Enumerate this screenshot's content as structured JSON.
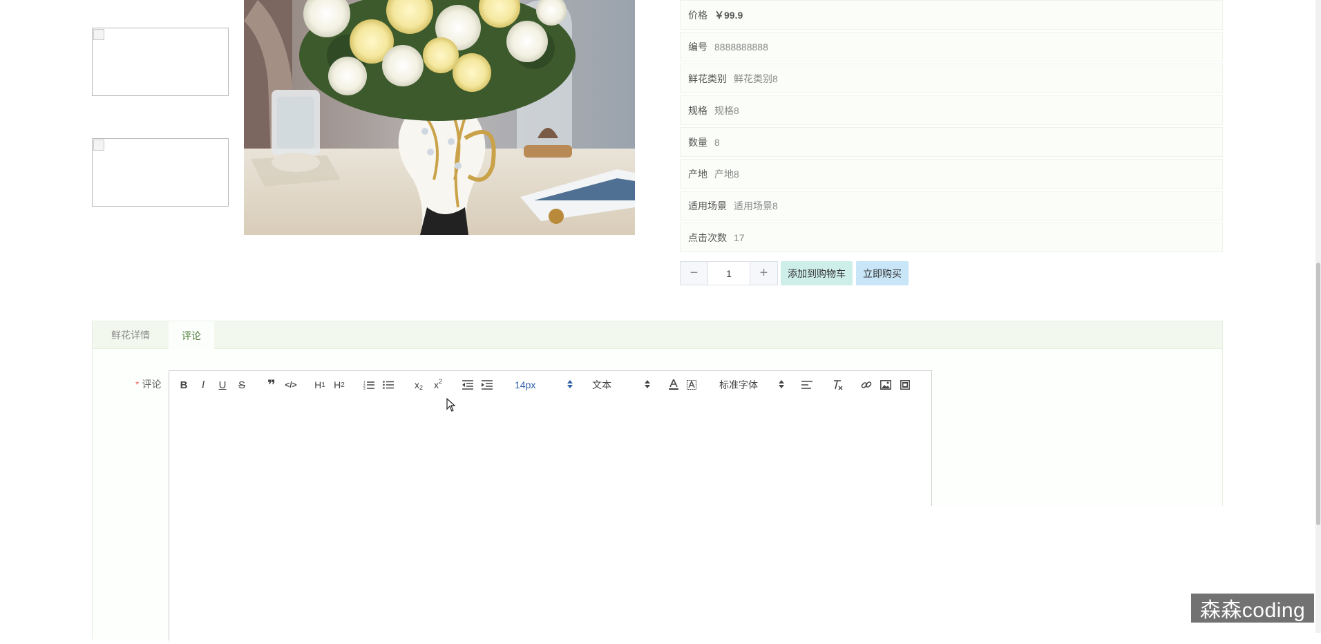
{
  "gallery": {
    "thumbnails": [
      {
        "broken": true
      },
      {
        "broken": true
      }
    ]
  },
  "product": {
    "fields": [
      {
        "label": "价格",
        "value": "￥99.9"
      },
      {
        "label": "编号",
        "value": "8888888888"
      },
      {
        "label": "鲜花类别",
        "value": "鲜花类别8"
      },
      {
        "label": "规格",
        "value": "规格8"
      },
      {
        "label": "数量",
        "value": "8"
      },
      {
        "label": "产地",
        "value": "产地8"
      },
      {
        "label": "适用场景",
        "value": "适用场景8"
      },
      {
        "label": "点击次数",
        "value": "17"
      }
    ]
  },
  "purchase": {
    "minus": "−",
    "quantity": "1",
    "plus": "+",
    "add_to_cart": "添加到购物车",
    "buy_now": "立即购买"
  },
  "tabs": [
    {
      "label": "鲜花详情",
      "active": false
    },
    {
      "label": "评论",
      "active": true
    }
  ],
  "comment_form": {
    "required_mark": "*",
    "label": "评论",
    "toolbar": {
      "font_size": "14px",
      "header": "文本",
      "font_family": "标准字体"
    }
  },
  "watermark": "森森coding",
  "colors": {
    "accent_green": "#4a7a34",
    "add_cart_bg": "#cdeee9",
    "buy_now_bg": "#c8e6f8",
    "picker_blue": "#2f5fa8"
  }
}
